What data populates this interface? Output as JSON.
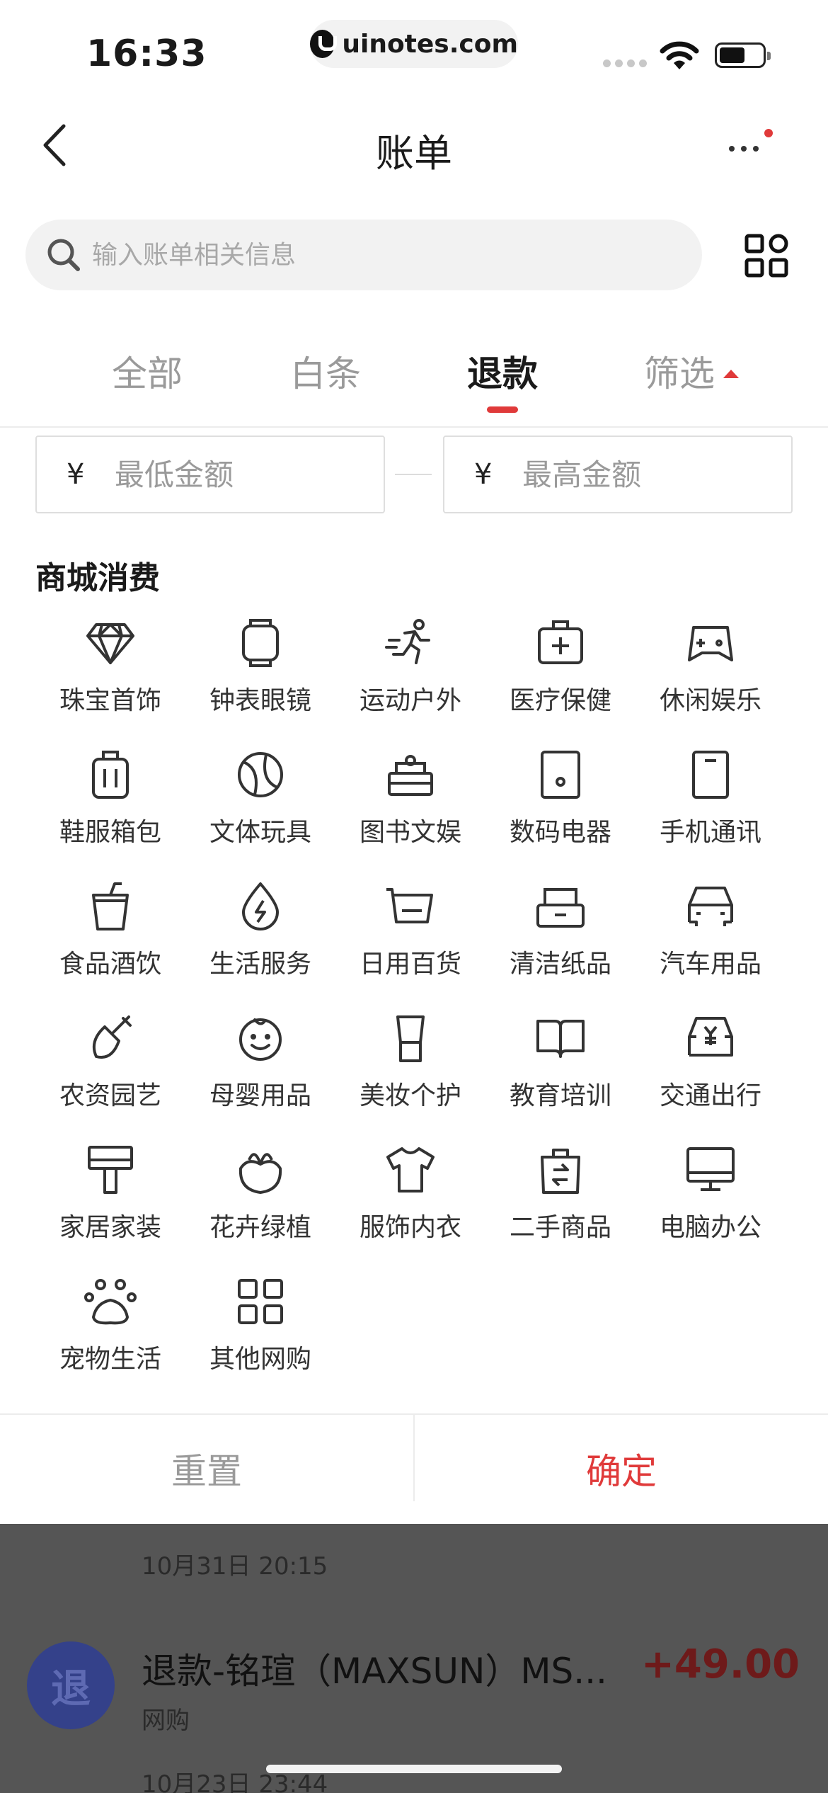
{
  "status_bar": {
    "time": "16:33",
    "url": "uinotes.com"
  },
  "nav": {
    "title": "账单"
  },
  "search": {
    "placeholder": "输入账单相关信息"
  },
  "tabs": [
    {
      "label": "全部",
      "active": false
    },
    {
      "label": "白条",
      "active": false
    },
    {
      "label": "退款",
      "active": true
    },
    {
      "label": "筛选",
      "active": false
    }
  ],
  "amount": {
    "currency": "¥",
    "min_placeholder": "最低金额",
    "max_placeholder": "最高金额"
  },
  "section": {
    "title": "商城消费"
  },
  "categories": [
    {
      "label": "珠宝首饰",
      "icon": "diamond-icon"
    },
    {
      "label": "钟表眼镜",
      "icon": "watch-icon"
    },
    {
      "label": "运动户外",
      "icon": "running-icon"
    },
    {
      "label": "医疗保健",
      "icon": "medical-kit-icon"
    },
    {
      "label": "休闲娱乐",
      "icon": "gamepad-icon"
    },
    {
      "label": "鞋服箱包",
      "icon": "luggage-icon"
    },
    {
      "label": "文体玩具",
      "icon": "ball-icon"
    },
    {
      "label": "图书文娱",
      "icon": "book-stack-icon"
    },
    {
      "label": "数码电器",
      "icon": "tablet-icon"
    },
    {
      "label": "手机通讯",
      "icon": "phone-icon"
    },
    {
      "label": "食品酒饮",
      "icon": "cup-icon"
    },
    {
      "label": "生活服务",
      "icon": "power-drop-icon"
    },
    {
      "label": "日用百货",
      "icon": "cart-icon"
    },
    {
      "label": "清洁纸品",
      "icon": "tissue-box-icon"
    },
    {
      "label": "汽车用品",
      "icon": "car-icon"
    },
    {
      "label": "农资园艺",
      "icon": "shovel-icon"
    },
    {
      "label": "母婴用品",
      "icon": "baby-face-icon"
    },
    {
      "label": "美妆个护",
      "icon": "cosmetic-icon"
    },
    {
      "label": "教育培训",
      "icon": "open-book-icon"
    },
    {
      "label": "交通出行",
      "icon": "taxi-icon"
    },
    {
      "label": "家居家装",
      "icon": "paint-roller-icon"
    },
    {
      "label": "花卉绿植",
      "icon": "flower-icon"
    },
    {
      "label": "服饰内衣",
      "icon": "tshirt-icon"
    },
    {
      "label": "二手商品",
      "icon": "exchange-bag-icon"
    },
    {
      "label": "电脑办公",
      "icon": "monitor-icon"
    },
    {
      "label": "宠物生活",
      "icon": "paw-icon"
    },
    {
      "label": "其他网购",
      "icon": "apps-grid-icon"
    }
  ],
  "footer": {
    "reset": "重置",
    "confirm": "确定"
  },
  "background_list": {
    "date1": "10月31日 20:15",
    "avatar": "退",
    "title": "退款-铭瑄（MAXSUN）MS...",
    "amount": "+49.00",
    "subtitle": "网购",
    "date2": "10月23日 23:44"
  },
  "colors": {
    "accent": "#e03a3a",
    "overlay": "#555555"
  }
}
